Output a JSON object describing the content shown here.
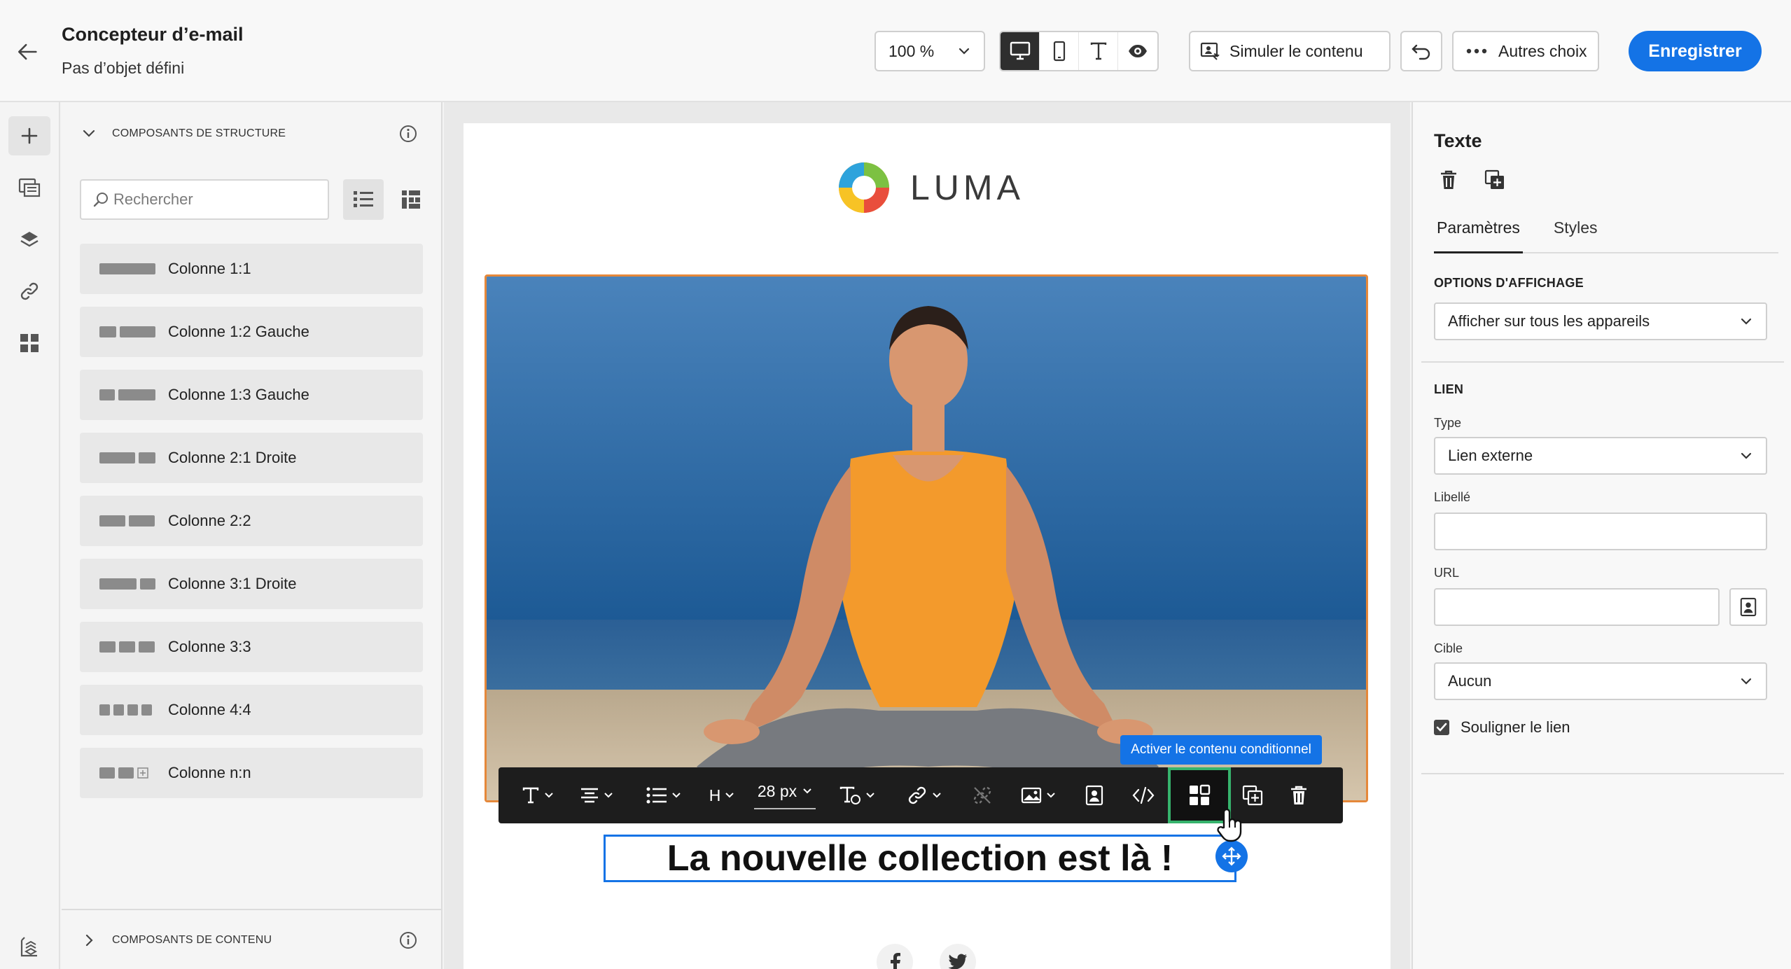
{
  "header": {
    "title": "Concepteur d’e-mail",
    "subtitle": "Pas d’objet défini",
    "zoom_value": "100 %",
    "simulate_label": "Simuler le contenu",
    "more_label": "Autres choix",
    "save_label": "Enregistrer"
  },
  "left_panel": {
    "structure_section": "COMPOSANTS DE STRUCTURE",
    "search_placeholder": "Rechercher",
    "items": [
      {
        "label": "Colonne 1:1"
      },
      {
        "label": "Colonne 1:2 Gauche"
      },
      {
        "label": "Colonne 1:3 Gauche"
      },
      {
        "label": "Colonne 2:1 Droite"
      },
      {
        "label": "Colonne 2:2"
      },
      {
        "label": "Colonne 3:1 Droite"
      },
      {
        "label": "Colonne 3:3"
      },
      {
        "label": "Colonne 4:4"
      },
      {
        "label": "Colonne n:n"
      }
    ],
    "content_section": "COMPOSANTS DE CONTENU"
  },
  "canvas": {
    "logo_text": "LUMA",
    "headline": "La nouvelle collection est là !",
    "toolbar": {
      "font_size": "28 px",
      "heading_label": "H",
      "tooltip": "Activer le contenu conditionnel"
    }
  },
  "right_panel": {
    "title": "Texte",
    "tabs": [
      "Paramètres",
      "Styles"
    ],
    "display_options_label": "OPTIONS D'AFFICHAGE",
    "display_options_value": "Afficher sur tous les appareils",
    "link_section": "LIEN",
    "type_label": "Type",
    "type_value": "Lien externe",
    "label_label": "Libellé",
    "label_value": "",
    "url_label": "URL",
    "url_value": "",
    "target_label": "Cible",
    "target_value": "Aucun",
    "underline_label": "Souligner le lien",
    "underline_checked": true
  },
  "colors": {
    "accent": "#1473e6",
    "selection_orange": "#e5883a",
    "highlight_green": "#36b36c",
    "toolbar_bg": "#1d1d1d"
  }
}
